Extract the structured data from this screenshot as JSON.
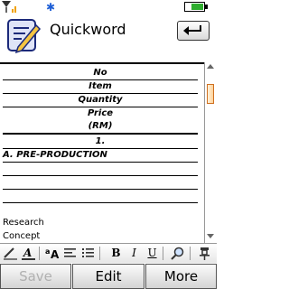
{
  "app": {
    "title": "Quickword"
  },
  "document": {
    "header_rows": [
      "No",
      "Item",
      "Quantity",
      "Price",
      "(RM)"
    ],
    "rows": [
      "1.",
      "A. PRE-PRODUCTION",
      "",
      "",
      ""
    ],
    "paragraphs": [
      "Research",
      "Concept"
    ]
  },
  "toolbar": {
    "bold": "B",
    "italic": "I",
    "underline": "U"
  },
  "softkeys": {
    "left": "Save",
    "center": "Edit",
    "right": "More"
  },
  "colors": {
    "bluetooth": "#1f5fd6",
    "battery": "#2fae2f",
    "scroll_thumb": "#ffd29a"
  }
}
